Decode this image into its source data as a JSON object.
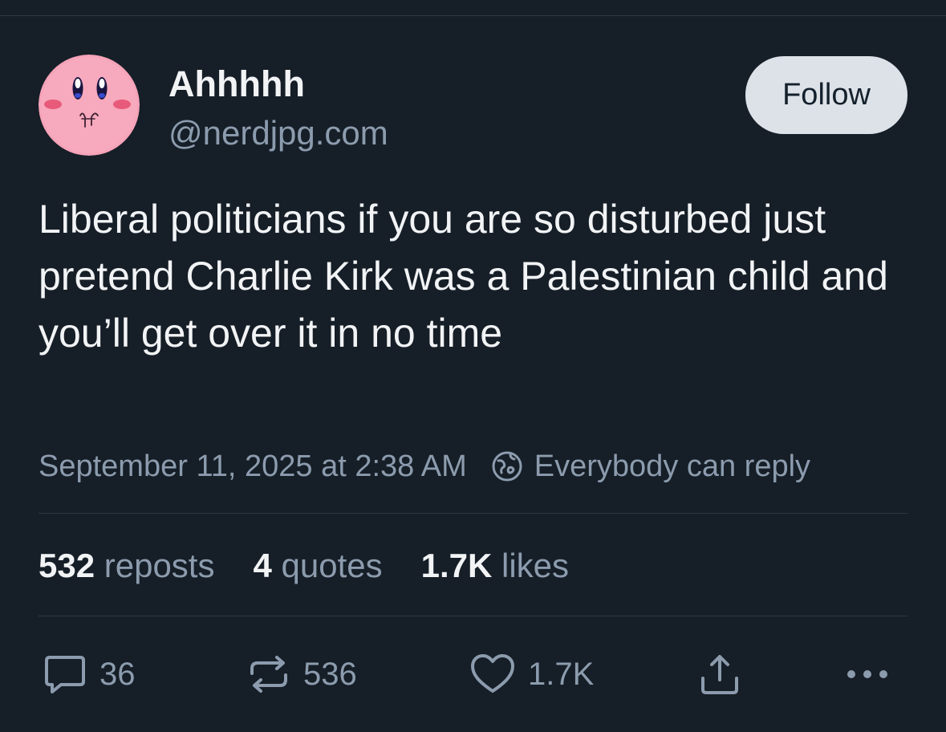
{
  "author": {
    "display_name": "Ahhhhh",
    "handle": "@nerdjpg.com"
  },
  "follow_label": "Follow",
  "post": {
    "text": "Liberal politicians if you are so disturbed just pretend Charlie Kirk was a Palestinian child and you’ll get over it in no time",
    "timestamp": "September 11, 2025 at 2:38 AM",
    "reply_setting": "Everybody can reply"
  },
  "stats": {
    "reposts_count": "532",
    "reposts_label": "reposts",
    "quotes_count": "4",
    "quotes_label": "quotes",
    "likes_count": "1.7K",
    "likes_label": "likes"
  },
  "actions": {
    "reply_count": "36",
    "repost_count": "536",
    "like_count": "1.7K"
  },
  "icons": {
    "reply": "speech-bubble-icon",
    "repost": "repost-arrows-icon",
    "like": "heart-icon",
    "share": "share-upload-icon",
    "more": "more-dots-icon",
    "reply_setting": "globe-icon"
  },
  "colors": {
    "background": "#161e27",
    "primary_text": "#f1f3f5",
    "secondary_text": "#8c9cae",
    "follow_button_bg": "#dde2e8",
    "avatar_pink": "#f5a3b8"
  }
}
